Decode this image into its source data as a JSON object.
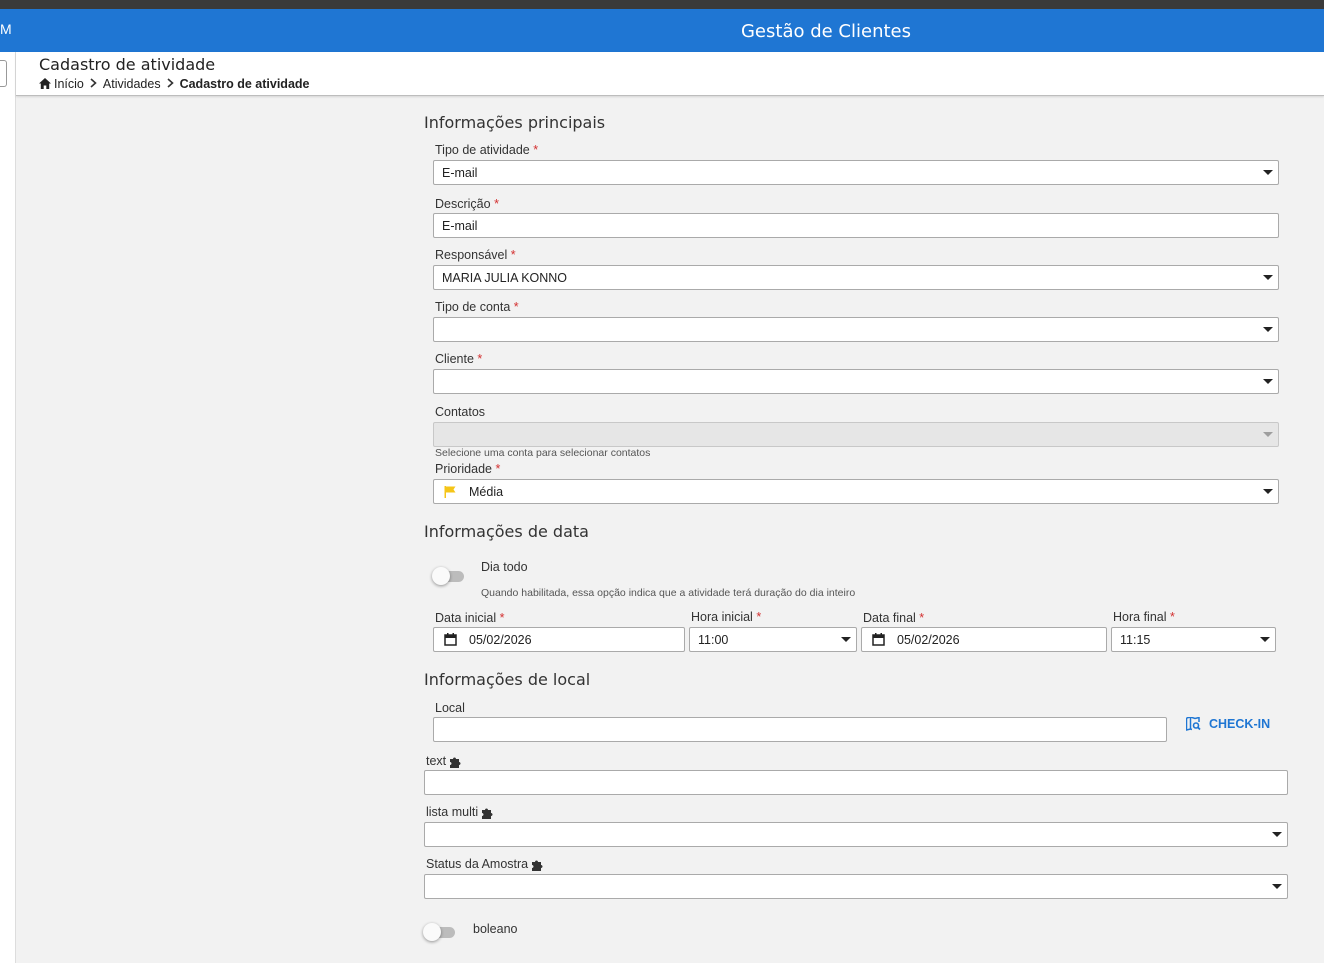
{
  "app": {
    "corner_text": "M",
    "title": "Gestão de Clientes"
  },
  "page": {
    "title": "Cadastro de atividade",
    "breadcrumb": [
      "Início",
      "Atividades",
      "Cadastro de atividade"
    ]
  },
  "sections": {
    "main": "Informações principais",
    "date": "Informações de data",
    "location": "Informações de local"
  },
  "fields": {
    "tipo_atividade": {
      "label": "Tipo de atividade",
      "value": "E-mail"
    },
    "descricao": {
      "label": "Descrição",
      "value": "E-mail"
    },
    "responsavel": {
      "label": "Responsável",
      "value": "MARIA JULIA KONNO"
    },
    "tipo_conta": {
      "label": "Tipo de conta",
      "value": ""
    },
    "cliente": {
      "label": "Cliente",
      "value": ""
    },
    "contatos": {
      "label": "Contatos",
      "value": "",
      "hint": "Selecione uma conta para selecionar contatos"
    },
    "prioridade": {
      "label": "Prioridade",
      "value": "Média",
      "flag_color": "#f5c518"
    },
    "dia_todo": {
      "label": "Dia todo",
      "hint": "Quando habilitada, essa opção indica que a atividade terá duração do dia inteiro",
      "enabled": false
    },
    "data_inicial": {
      "label": "Data inicial",
      "value": "05/02/2026"
    },
    "hora_inicial": {
      "label": "Hora inicial",
      "value": "11:00"
    },
    "data_final": {
      "label": "Data final",
      "value": "05/02/2026"
    },
    "hora_final": {
      "label": "Hora final",
      "value": "11:15"
    },
    "local": {
      "label": "Local",
      "value": ""
    },
    "checkin": {
      "label": "CHECK-IN"
    },
    "text": {
      "label": "text",
      "value": ""
    },
    "lista_multi": {
      "label": "lista multi",
      "value": ""
    },
    "status_amostra": {
      "label": "Status da Amostra",
      "value": ""
    },
    "boleano": {
      "label": "boleano",
      "enabled": false
    }
  },
  "required_marker": "*",
  "colors": {
    "appbar": "#1f76d3",
    "required": "#d32f2f",
    "accent": "#1f76d3"
  }
}
